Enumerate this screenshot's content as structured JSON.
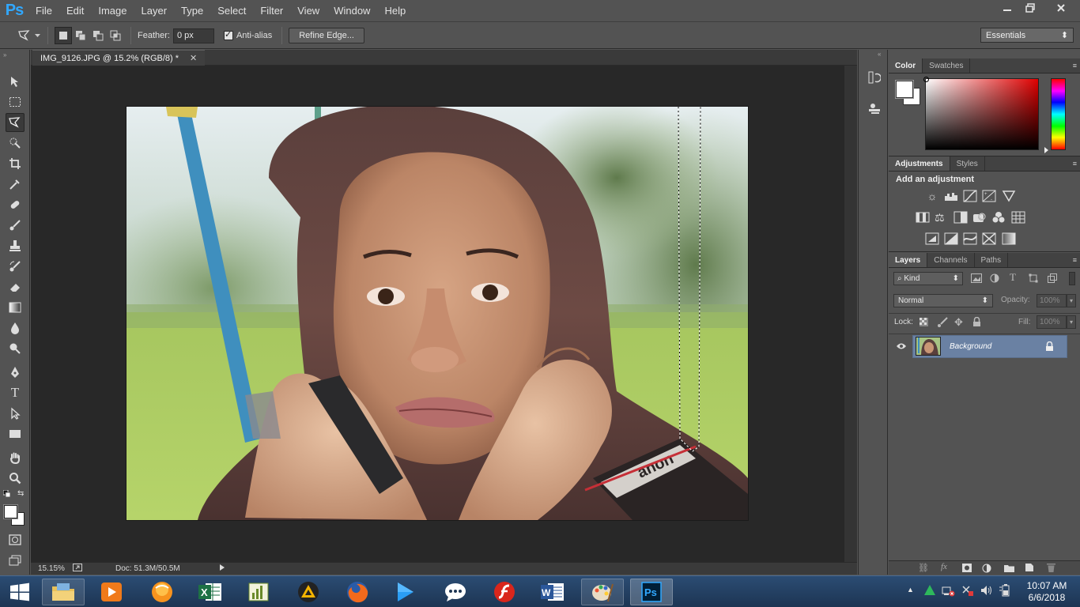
{
  "app": {
    "logo": "Ps",
    "menu": [
      "File",
      "Edit",
      "Image",
      "Layer",
      "Type",
      "Select",
      "Filter",
      "View",
      "Window",
      "Help"
    ],
    "window_controls": [
      "minimize-icon",
      "restore-icon",
      "close-icon"
    ]
  },
  "options": {
    "feather_label": "Feather:",
    "feather_value": "0 px",
    "antialias_label": "Anti-alias",
    "antialias_checked": true,
    "refine_edge_label": "Refine Edge...",
    "workspace": "Essentials"
  },
  "document": {
    "tab_title": "IMG_9126.JPG @ 15.2% (RGB/8) *",
    "zoom": "15.15%",
    "doc_size": "Doc: 51.3M/50.5M"
  },
  "panels": {
    "color": {
      "tabs": [
        "Color",
        "Swatches"
      ],
      "foreground": "#ffffff",
      "background": "#ffffff",
      "hue": "#ff0000"
    },
    "adjustments": {
      "tabs": [
        "Adjustments",
        "Styles"
      ],
      "heading": "Add an adjustment"
    },
    "layers": {
      "tabs": [
        "Layers",
        "Channels",
        "Paths"
      ],
      "filter_kind": "Kind",
      "blend_mode": "Normal",
      "opacity_label": "Opacity:",
      "opacity_value": "100%",
      "lock_label": "Lock:",
      "fill_label": "Fill:",
      "fill_value": "100%",
      "layer_name": "Background"
    }
  },
  "taskbar": {
    "time": "10:07 AM",
    "date": "6/6/2018"
  },
  "colors": {
    "ps_blue": "#31a8ff",
    "layer_selected": "#6a81a3"
  }
}
